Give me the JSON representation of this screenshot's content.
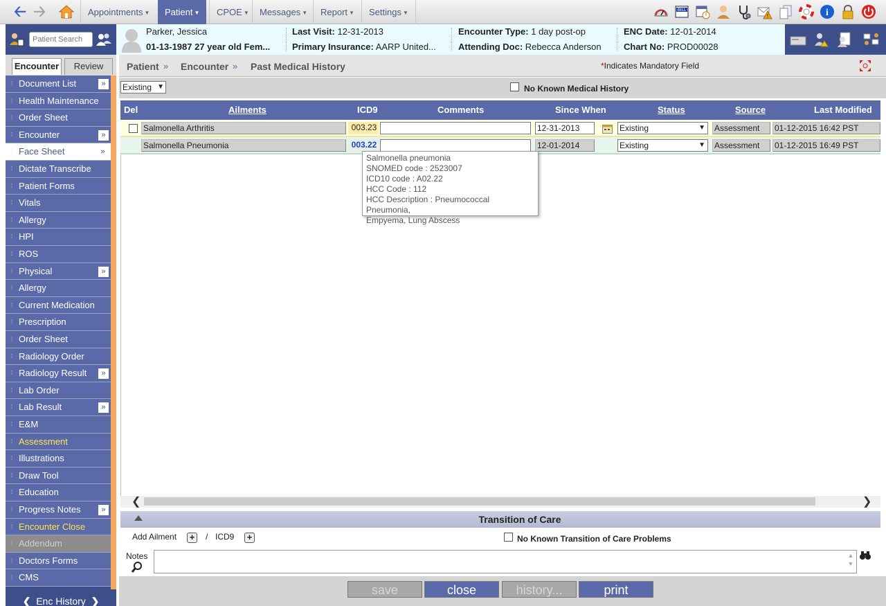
{
  "topnav": {
    "menu": [
      {
        "label": "Appointments"
      },
      {
        "label": "Patient"
      },
      {
        "label": "CPOE"
      },
      {
        "label": "Messages"
      },
      {
        "label": "Report"
      },
      {
        "label": "Settings"
      }
    ],
    "active_menu": "Patient",
    "tool_icons": [
      "dashboard-icon",
      "bill-icon",
      "calendar-clock-icon",
      "user-icon",
      "stethoscope-icon",
      "mail-alert-icon",
      "documents-icon",
      "lifebuoy-icon",
      "info-icon",
      "lock-icon",
      "power-icon"
    ]
  },
  "search": {
    "placeholder": "Patient Search"
  },
  "patient": {
    "name": "Parker, Jessica",
    "dob_age": "01-13-1987 27 year old Fem...",
    "last_visit_label": "Last Visit:",
    "last_visit": "12-31-2013",
    "insurance_label": "Primary Insurance:",
    "insurance": "AARP United...",
    "encounter_type_label": "Encounter Type:",
    "encounter_type": "1 day post-op",
    "attending_label": "Attending Doc:",
    "attending": "Rebecca Anderson",
    "enc_date_label": "ENC Date:",
    "enc_date": "12-01-2014",
    "chart_label": "Chart No:",
    "chart_no": "PROD00028"
  },
  "side_tabs": {
    "encounter": "Encounter",
    "review": "Review"
  },
  "sidebar": {
    "items": [
      {
        "label": "Document List",
        "expand": true,
        "state": "normal"
      },
      {
        "label": "Health Maintenance",
        "expand": false,
        "state": "normal"
      },
      {
        "label": "Order Sheet",
        "expand": false,
        "state": "normal"
      },
      {
        "label": "Encounter",
        "expand": true,
        "state": "normal"
      },
      {
        "label": "Face Sheet",
        "expand": true,
        "state": "selected"
      },
      {
        "label": "Dictate Transcribe",
        "expand": false,
        "state": "normal"
      },
      {
        "label": "Patient Forms",
        "expand": false,
        "state": "normal"
      },
      {
        "label": "Vitals",
        "expand": false,
        "state": "normal"
      },
      {
        "label": "Allergy",
        "expand": false,
        "state": "normal"
      },
      {
        "label": "HPI",
        "expand": false,
        "state": "normal"
      },
      {
        "label": "ROS",
        "expand": false,
        "state": "normal"
      },
      {
        "label": "Physical",
        "expand": true,
        "state": "normal"
      },
      {
        "label": "Allergy",
        "expand": false,
        "state": "normal"
      },
      {
        "label": "Current Medication",
        "expand": false,
        "state": "normal"
      },
      {
        "label": "Prescription",
        "expand": false,
        "state": "normal"
      },
      {
        "label": "Order Sheet",
        "expand": false,
        "state": "normal"
      },
      {
        "label": "Radiology Order",
        "expand": false,
        "state": "normal"
      },
      {
        "label": "Radiology Result",
        "expand": true,
        "state": "normal"
      },
      {
        "label": "Lab Order",
        "expand": false,
        "state": "normal"
      },
      {
        "label": "Lab Result",
        "expand": true,
        "state": "normal"
      },
      {
        "label": "E&M",
        "expand": false,
        "state": "normal"
      },
      {
        "label": "Assessment",
        "expand": false,
        "state": "yellow"
      },
      {
        "label": "Illustrations",
        "expand": false,
        "state": "normal"
      },
      {
        "label": "Draw Tool",
        "expand": false,
        "state": "normal"
      },
      {
        "label": "Education",
        "expand": false,
        "state": "normal"
      },
      {
        "label": "Progress Notes",
        "expand": true,
        "state": "normal"
      },
      {
        "label": "Encounter Close",
        "expand": false,
        "state": "yellow"
      },
      {
        "label": "Addendum",
        "expand": false,
        "state": "disabled"
      },
      {
        "label": "Doctors Forms",
        "expand": false,
        "state": "normal"
      },
      {
        "label": "CMS",
        "expand": false,
        "state": "normal"
      }
    ],
    "enc_history": "Enc History"
  },
  "breadcrumb": [
    "Patient",
    "Encounter",
    "Past Medical History"
  ],
  "breadcrumb_sep": "»",
  "mandatory_note": "Indicates Mandatory Field",
  "filter": {
    "value": "Existing"
  },
  "no_known_history_label": "No Known Medical History",
  "grid": {
    "columns": {
      "del": "Del",
      "ailments": "Ailments",
      "icd9": "ICD9",
      "comments": "Comments",
      "since_when": "Since When",
      "status": "Status",
      "source": "Source",
      "last_modified": "Last Modified"
    },
    "rows": [
      {
        "ailment": "Salmonella Arthritis",
        "icd9": "003.23",
        "comment": "",
        "since": "12-31-2013",
        "status": "Existing",
        "source": "Assessment",
        "modified": "01-12-2015 16:42 PST"
      },
      {
        "ailment": "Salmonella Pneumonia",
        "icd9": "003.22",
        "comment": "",
        "since": "12-01-2014",
        "status": "Existing",
        "source": "Assessment",
        "modified": "01-12-2015 16:49 PST"
      }
    ]
  },
  "tooltip": {
    "line1": "Salmonella pneumonia",
    "line2": "SNOMED code : 2523007",
    "line3": "ICD10 code : A02.22",
    "line4": "HCC Code : 112",
    "line5": "HCC Description : Pneumococcal Pneumonia,",
    "line6": "Empyema, Lung Abscess"
  },
  "toc": {
    "title": "Transition of Care",
    "add_ailment": "Add Ailment",
    "slash": "/",
    "icd9": "ICD9",
    "no_known_label": "No Known Transition of Care Problems"
  },
  "notes": {
    "label": "Notes"
  },
  "footer": {
    "save": "save",
    "close": "close",
    "history": "history...",
    "print": "print"
  },
  "colors": {
    "nav_blue": "#5a6aa8",
    "dark_blue": "#3d4f8a",
    "accent_orange": "#f5a85f",
    "highlight_yellow": "#ffe44d",
    "link_blue": "#1a3fd1"
  }
}
